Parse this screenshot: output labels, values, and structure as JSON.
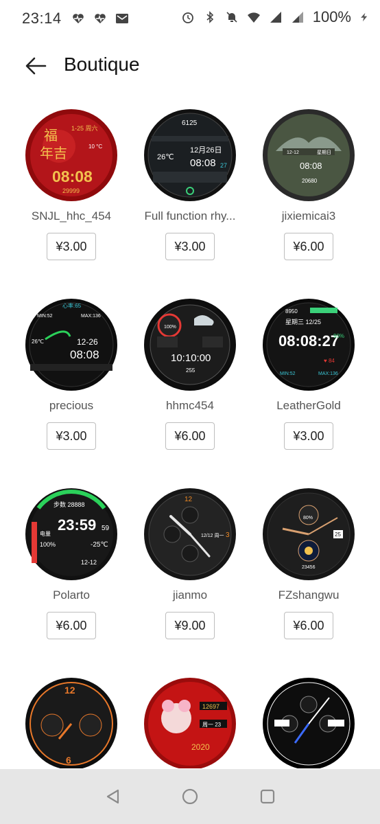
{
  "status_bar": {
    "time": "23:14",
    "battery_percent": "100%",
    "left_icons": [
      "heart-rate-icon",
      "heart-rate-icon",
      "gmail-icon"
    ],
    "right_icons": [
      "alarm-icon",
      "bluetooth-icon",
      "bell-off-icon",
      "wifi-icon",
      "signal-icon",
      "signal-icon",
      "charging-icon"
    ]
  },
  "header": {
    "title": "Boutique",
    "back_icon": "arrow-left-icon"
  },
  "watchfaces": [
    {
      "name": "SNJL_hhc_454",
      "price": "¥3.00",
      "theme": "#a10d10",
      "accent": "#f2c14e"
    },
    {
      "name": "Full function rhy...",
      "price": "¥3.00",
      "theme": "#1b1f22",
      "accent": "#ffffff"
    },
    {
      "name": "jixiemicai3",
      "price": "¥6.00",
      "theme": "#3f4a3a",
      "accent": "#ffffff"
    },
    {
      "name": "precious",
      "price": "¥3.00",
      "theme": "#111111",
      "accent": "#3bc6d6"
    },
    {
      "name": "hhmc454",
      "price": "¥6.00",
      "theme": "#1c1c1c",
      "accent": "#e53935"
    },
    {
      "name": "LeatherGold",
      "price": "¥3.00",
      "theme": "#141414",
      "accent": "#3bd17a"
    },
    {
      "name": "Polarto",
      "price": "¥6.00",
      "theme": "#181818",
      "accent": "#e53935"
    },
    {
      "name": "jianmo",
      "price": "¥9.00",
      "theme": "#232323",
      "accent": "#f08a24"
    },
    {
      "name": "FZshangwu",
      "price": "¥6.00",
      "theme": "#1e1e1e",
      "accent": "#d8a070"
    },
    {
      "name": "",
      "price": "",
      "theme": "#1a1a1a",
      "accent": "#e8782a"
    },
    {
      "name": "",
      "price": "",
      "theme": "#c41414",
      "accent": "#f2c14e"
    },
    {
      "name": "",
      "price": "",
      "theme": "#0d0d0d",
      "accent": "#ffffff"
    }
  ],
  "nav_bar": {
    "icons": [
      "back-triangle-icon",
      "home-circle-icon",
      "recents-square-icon"
    ],
    "background": "#e6e6e6"
  }
}
